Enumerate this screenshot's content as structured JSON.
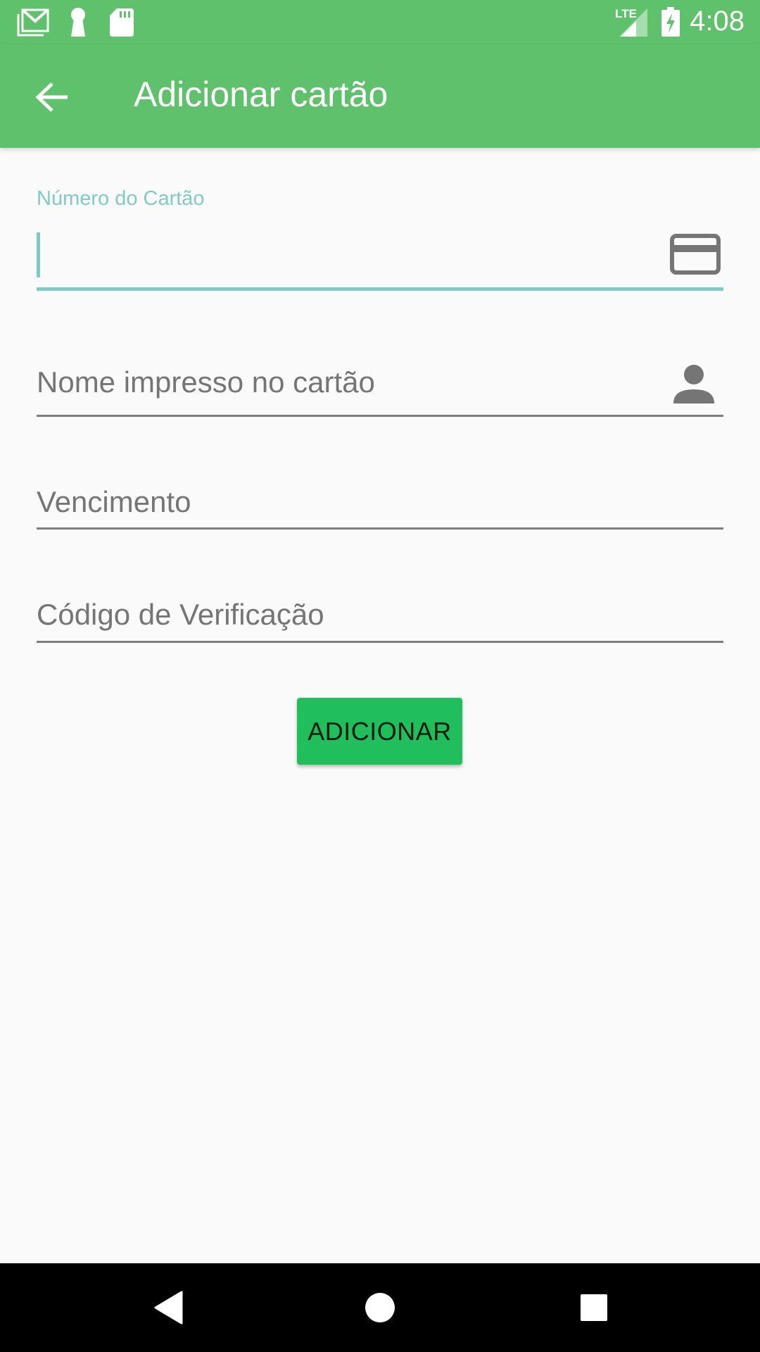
{
  "status_bar": {
    "time": "4:08",
    "network": "LTE",
    "icons": [
      "gmail-icon",
      "keyhole-icon",
      "sd-card-icon",
      "lte-signal-icon",
      "battery-charging-icon"
    ]
  },
  "app_bar": {
    "title": "Adicionar cartão",
    "back_icon": "arrow-back-icon"
  },
  "form": {
    "card_number": {
      "label": "Número do Cartão",
      "value": "",
      "icon": "credit-card-icon"
    },
    "card_name": {
      "placeholder": "Nome impresso no cartão",
      "value": "",
      "icon": "person-icon"
    },
    "expiry": {
      "placeholder": "Vencimento",
      "value": ""
    },
    "cvv": {
      "placeholder": "Código de Verificação",
      "value": ""
    },
    "submit_label": "ADICIONAR"
  },
  "nav_bar": {
    "icons": [
      "back-triangle-icon",
      "home-circle-icon",
      "recents-square-icon"
    ]
  },
  "colors": {
    "primary": "#5fc16b",
    "accent": "#80cbc4",
    "button": "#20bf5b",
    "hint_text": "#9e9e9e",
    "background": "#fafafa"
  }
}
